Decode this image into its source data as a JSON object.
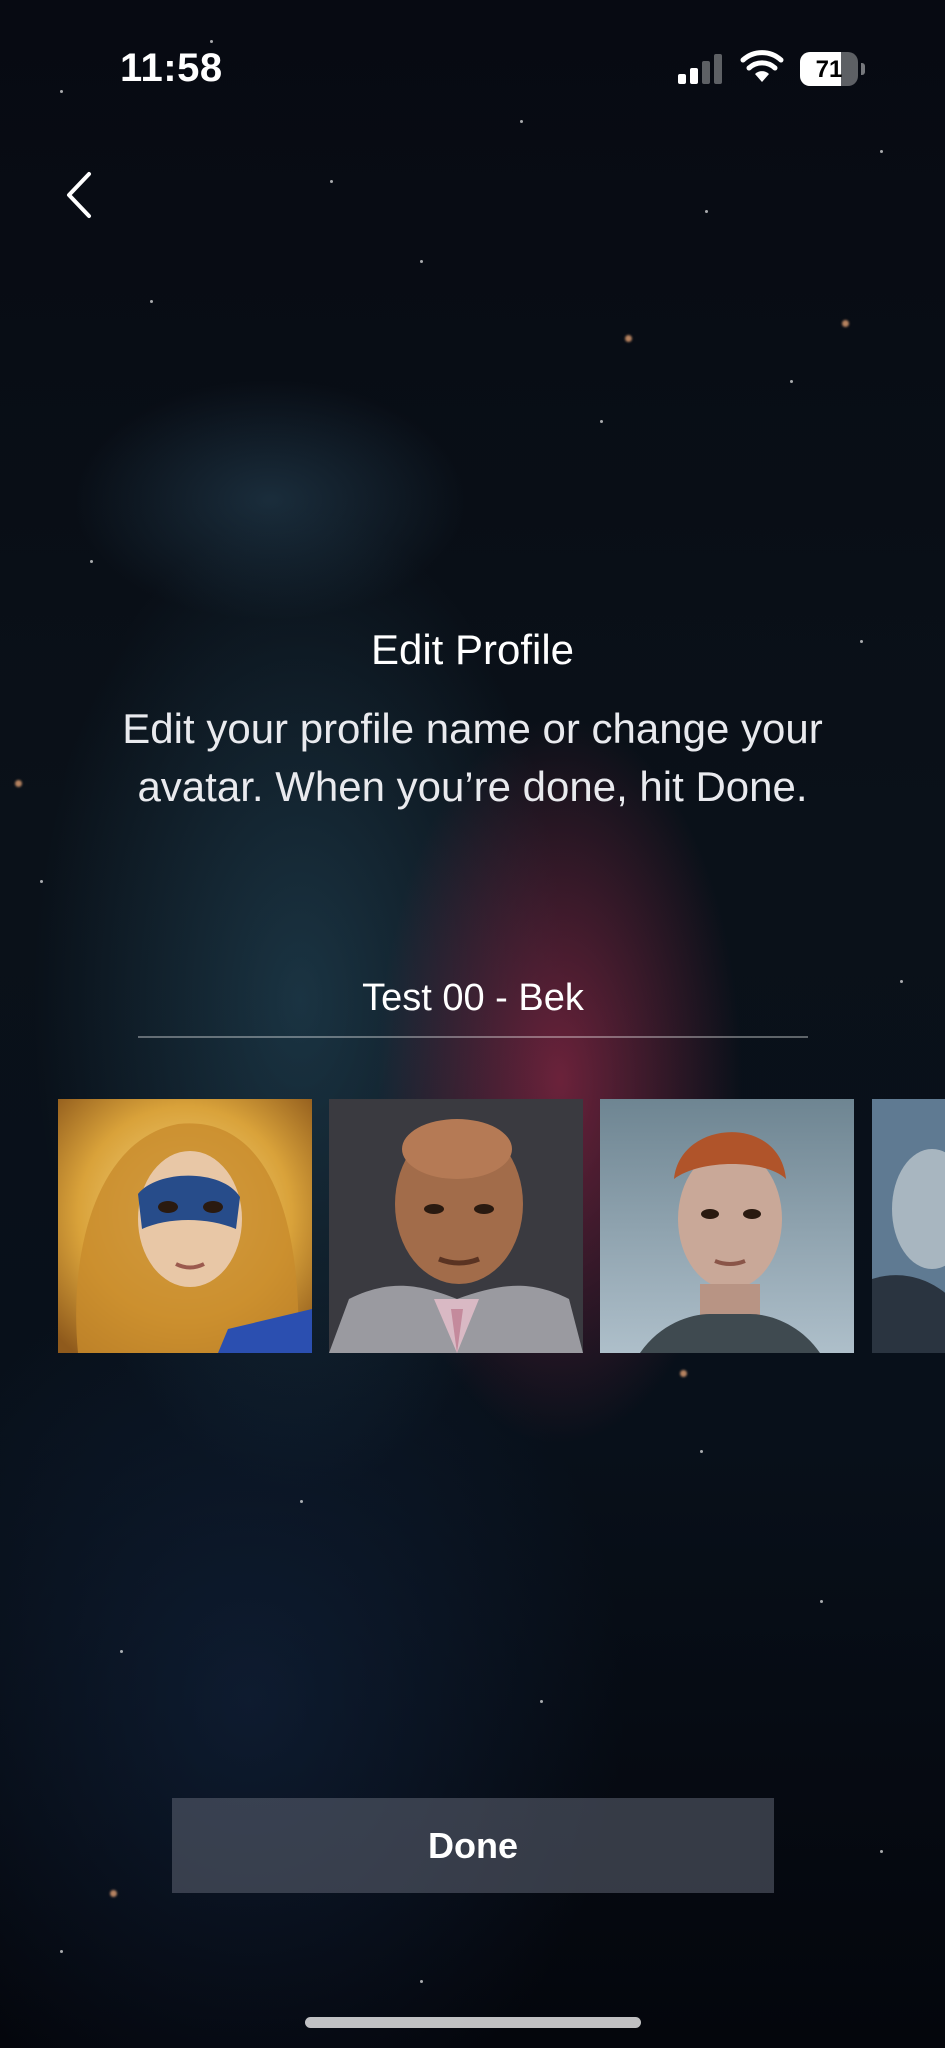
{
  "status_bar": {
    "time": "11:58",
    "battery_level": "71",
    "icons": [
      "cellular-signal-icon",
      "wifi-icon",
      "battery-icon"
    ]
  },
  "header": {
    "back_icon": "chevron-left-icon"
  },
  "main": {
    "title": "Edit Profile",
    "subtitle": "Edit your profile name or change your avatar. When you’re done, hit Done.",
    "profile_name_value": "Test 00 - Bek",
    "avatars": [
      {
        "description": "blonde-masked-hero"
      },
      {
        "description": "bald-man-suit"
      },
      {
        "description": "red-haired-woman"
      },
      {
        "description": "grey-haired-partial"
      }
    ]
  },
  "footer": {
    "done_label": "Done"
  },
  "colors": {
    "background": "#05070d",
    "button": "#4a4f5c",
    "text": "#ffffff"
  }
}
